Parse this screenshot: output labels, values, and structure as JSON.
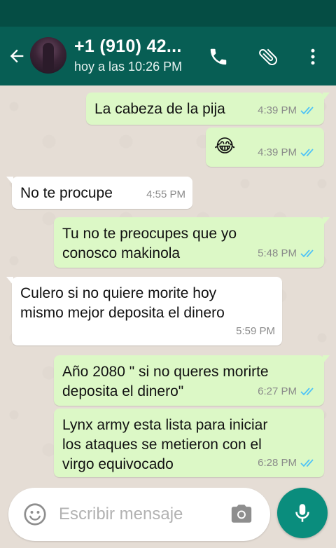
{
  "header": {
    "contact_name": "+1 (910) 42...",
    "last_seen": "hoy a las 10:26 PM"
  },
  "colors": {
    "status_bar": "#054d44",
    "app_bar": "#075e54",
    "outgoing_bubble": "#dcf8c6",
    "incoming_bubble": "#ffffff",
    "read_ticks": "#4fc3f7",
    "mic_button": "#0a8d7d"
  },
  "messages": [
    {
      "direction": "out",
      "text": "La cabeza de la pija",
      "time": "4:39 PM",
      "status": "read"
    },
    {
      "direction": "out",
      "text": "😂",
      "time": "4:39 PM",
      "status": "read"
    },
    {
      "direction": "in",
      "text": "No te procupe",
      "time": "4:55 PM"
    },
    {
      "direction": "out",
      "text": "Tu no te preocupes que yo\nconosco makinola",
      "time": "5:48 PM",
      "status": "read"
    },
    {
      "direction": "in",
      "text": "Culero si no quiere morite hoy\nmismo mejor deposita el dinero",
      "time": "5:59 PM"
    },
    {
      "direction": "out",
      "text": "Año 2080 \" si no queres morirte\ndeposita el dinero\"",
      "time": "6:27 PM",
      "status": "read"
    },
    {
      "direction": "out",
      "text": "Lynx army esta lista para iniciar\nlos ataques se metieron con el\nvirgo equivocado",
      "time": "6:28 PM",
      "status": "read"
    }
  ],
  "composer": {
    "placeholder": "Escribir mensaje"
  },
  "icons": {
    "back": "arrow-left-icon",
    "call": "phone-icon",
    "attach": "paperclip-icon",
    "menu": "more-vert-icon",
    "emoji": "smiley-icon",
    "camera": "camera-icon",
    "mic": "microphone-icon",
    "ticks": "double-check-icon"
  }
}
